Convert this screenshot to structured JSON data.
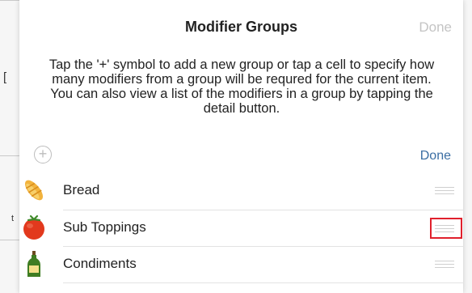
{
  "modal": {
    "title": "Modifier Groups",
    "done_label": "Done",
    "instructions": "Tap the '+' symbol to add a new group or tap a cell to specify how many modifiers from a group will be requred for the current item. You can also view a list of the modifiers in a group by tapping the detail button."
  },
  "list": {
    "add_symbol": "+",
    "done_label": "Done",
    "items": [
      {
        "label": "Bread",
        "icon": "bread-icon"
      },
      {
        "label": "Sub Toppings",
        "icon": "tomato-icon",
        "highlighted": true
      },
      {
        "label": "Condiments",
        "icon": "bottle-icon"
      }
    ]
  },
  "background": {
    "left_chars": [
      "[",
      "t"
    ]
  },
  "colors": {
    "accent": "#3b6ea3",
    "disabled": "#c4c4c4",
    "highlight": "#e0202c"
  }
}
